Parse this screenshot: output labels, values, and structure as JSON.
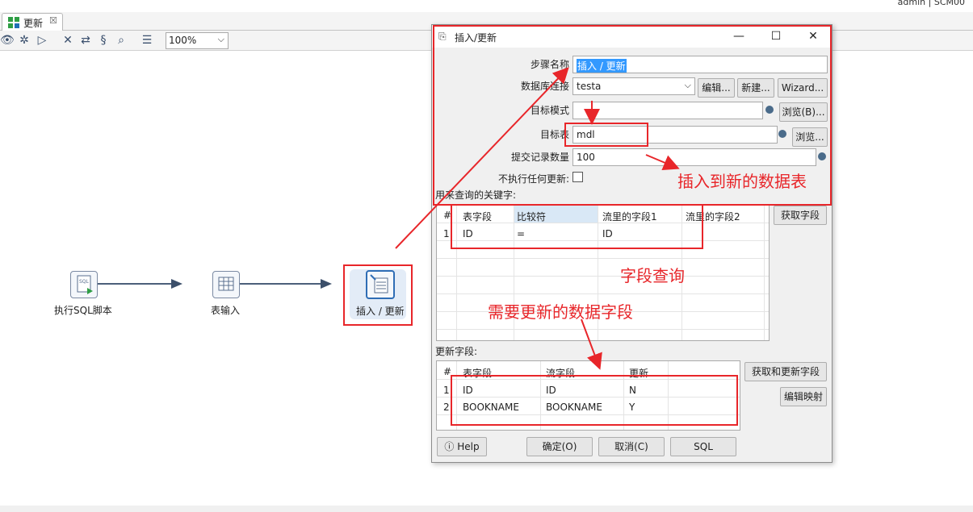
{
  "top": {
    "user_text": "admin  |  SCM00"
  },
  "tab": {
    "label": "更新",
    "close": "☒"
  },
  "toolbar": {
    "zoom": "100%"
  },
  "steps": [
    {
      "label": "执行SQL脚本",
      "icon": "sql-script-icon"
    },
    {
      "label": "表输入",
      "icon": "table-input-icon"
    },
    {
      "label": "插入 / 更新",
      "icon": "insert-update-icon"
    }
  ],
  "dialog": {
    "title": "插入/更新",
    "step_name_label": "步骤名称",
    "step_name_value": "插入 / 更新",
    "db_conn_label": "数据库连接",
    "db_conn_value": "testa",
    "edit_btn": "编辑...",
    "new_btn": "新建...",
    "wizard_btn": "Wizard...",
    "schema_label": "目标模式",
    "schema_value": "",
    "browse_b_btn": "浏览(B)...",
    "table_label": "目标表",
    "table_value": "mdl",
    "browse_btn": "浏览...",
    "commit_label": "提交记录数量",
    "commit_value": "100",
    "noupdate_label": "不执行任何更新:",
    "keys_label": "用来查询的关键字:",
    "get_fields_btn": "获取字段",
    "keys_table": {
      "headers": [
        "#",
        "表字段",
        "比较符",
        "流里的字段1",
        "流里的字段2"
      ],
      "rows": [
        [
          "1",
          "ID",
          "=",
          "ID",
          ""
        ]
      ]
    },
    "update_label": "更新字段:",
    "get_update_btn": "获取和更新字段",
    "edit_mapping_btn": "编辑映射",
    "update_table": {
      "headers": [
        "#",
        "表字段",
        "流字段",
        "更新"
      ],
      "rows": [
        [
          "1",
          "ID",
          "ID",
          "N"
        ],
        [
          "2",
          "BOOKNAME",
          "BOOKNAME",
          "Y"
        ]
      ]
    },
    "help_btn": "Help",
    "ok_btn": "确定(O)",
    "cancel_btn": "取消(C)",
    "sql_btn": "SQL"
  },
  "annotations": {
    "insert_note": "插入到新的数据表",
    "query_note": "字段查询",
    "update_note": "需要更新的数据字段"
  },
  "colors": {
    "annotation": "#e8262a",
    "selection": "#3399ff"
  }
}
